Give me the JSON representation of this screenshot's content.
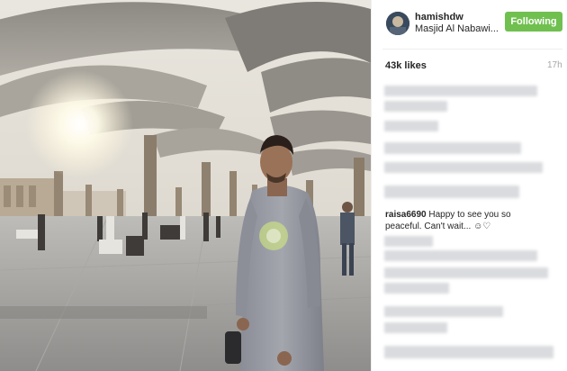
{
  "post": {
    "username": "hamishdw",
    "location": "Masjid Al Nabawi...",
    "follow_label": "Following",
    "likes": "43k likes",
    "time": "17h"
  },
  "comments": [
    {
      "user": "raisa6690",
      "text": "Happy to see you so peaceful. Can't wait... ☺︎♡"
    }
  ],
  "colors": {
    "follow_button": "#70c050",
    "redacted_text": "#d9dbde",
    "timestamp": "#a5a7aa"
  }
}
